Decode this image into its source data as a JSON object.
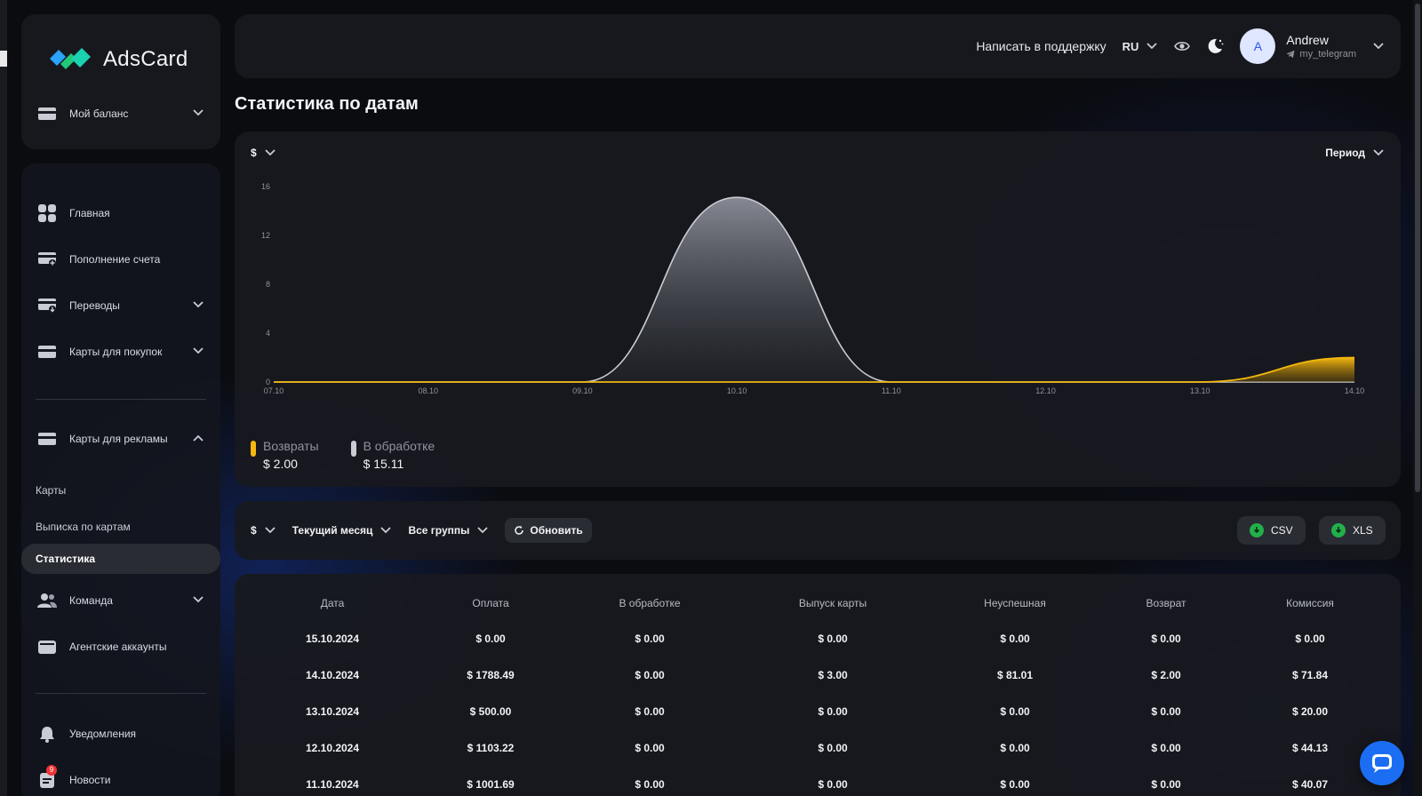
{
  "brand": {
    "name": "AdsCard"
  },
  "sidebar": {
    "balance": {
      "label": "Мой баланс"
    },
    "items": [
      {
        "label": "Главная",
        "icon": "grid-icon"
      },
      {
        "label": "Пополнение счета",
        "icon": "card-plus-icon"
      },
      {
        "label": "Переводы",
        "icon": "card-transfer-icon"
      },
      {
        "label": "Карты для покупок",
        "icon": "card-icon"
      },
      {
        "label": "Карты для рекламы",
        "icon": "card-icon"
      }
    ],
    "sub_items": [
      {
        "label": "Карты"
      },
      {
        "label": "Выписка по картам"
      },
      {
        "label": "Статистика"
      }
    ],
    "items2": [
      {
        "label": "Команда",
        "icon": "team-icon"
      },
      {
        "label": "Агентские аккаунты",
        "icon": "wallet-icon"
      },
      {
        "label": "Уведомления",
        "icon": "bell-icon"
      },
      {
        "label": "Новости",
        "icon": "news-icon",
        "badge": "9"
      }
    ]
  },
  "header": {
    "support": "Написать в поддержку",
    "lang": "RU",
    "user": {
      "avatar_letter": "A",
      "name": "Andrew",
      "telegram": "my_telegram"
    }
  },
  "page": {
    "title": "Статистика по датам"
  },
  "chart_controls": {
    "currency": "$",
    "period": "Период"
  },
  "chart_data": {
    "type": "area",
    "x": [
      "07.10",
      "08.10",
      "09.10",
      "10.10",
      "11.10",
      "12.10",
      "13.10",
      "14.10"
    ],
    "yticks": [
      0,
      4,
      8,
      12,
      16
    ],
    "ylim": [
      0,
      16
    ],
    "series": [
      {
        "name": "В обработке",
        "color": "#c9ccd2",
        "values": [
          0,
          0,
          0,
          15.11,
          0,
          0,
          0,
          0
        ]
      },
      {
        "name": "Возвраты",
        "color": "#f5b80f",
        "values": [
          0,
          0,
          0,
          0,
          0,
          0,
          0,
          2.0
        ]
      }
    ],
    "legend": [
      {
        "name": "Возвраты",
        "value": "$ 2.00",
        "color": "#f5b80f"
      },
      {
        "name": "В обработке",
        "value": "$ 15.11",
        "color": "#c9ccd2"
      }
    ]
  },
  "filters": {
    "currency": "$",
    "month": "Текущий месяц",
    "groups": "Все группы",
    "refresh": "Обновить",
    "csv": "CSV",
    "xls": "XLS"
  },
  "table": {
    "headers": [
      "Дата",
      "Оплата",
      "В обработке",
      "Выпуск карты",
      "Неуспешная",
      "Возврат",
      "Комиссия"
    ],
    "rows": [
      [
        "15.10.2024",
        "$ 0.00",
        "$ 0.00",
        "$ 0.00",
        "$ 0.00",
        "$ 0.00",
        "$ 0.00"
      ],
      [
        "14.10.2024",
        "$ 1788.49",
        "$ 0.00",
        "$ 3.00",
        "$ 81.01",
        "$ 2.00",
        "$ 71.84"
      ],
      [
        "13.10.2024",
        "$ 500.00",
        "$ 0.00",
        "$ 0.00",
        "$ 0.00",
        "$ 0.00",
        "$ 20.00"
      ],
      [
        "12.10.2024",
        "$ 1103.22",
        "$ 0.00",
        "$ 0.00",
        "$ 0.00",
        "$ 0.00",
        "$ 44.13"
      ],
      [
        "11.10.2024",
        "$ 1001.69",
        "$ 0.00",
        "$ 0.00",
        "$ 0.00",
        "$ 0.00",
        "$ 40.07"
      ]
    ]
  }
}
